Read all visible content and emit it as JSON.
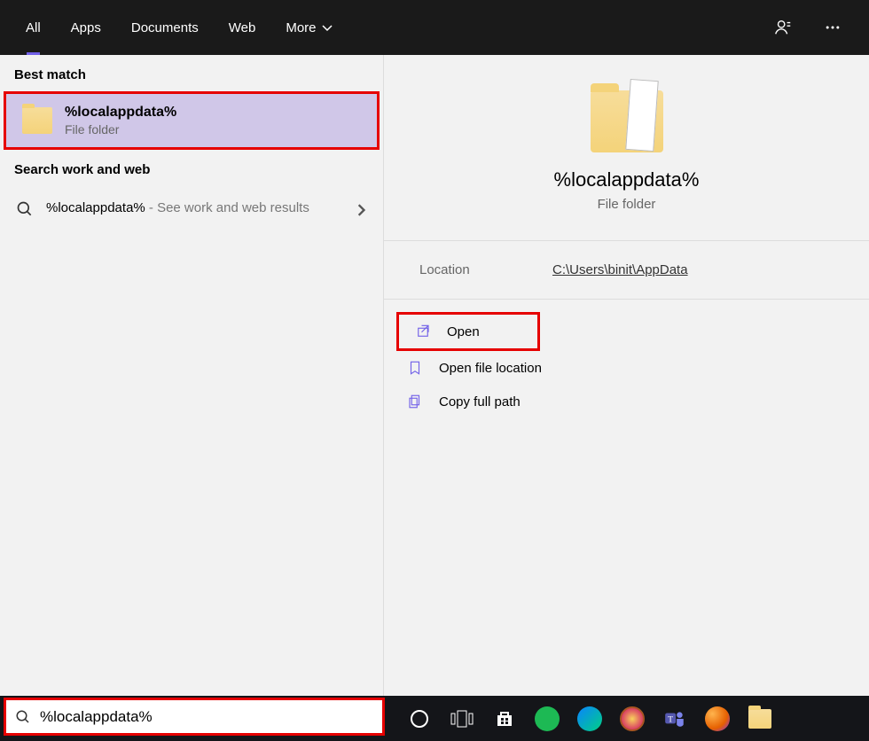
{
  "tabs": {
    "all": "All",
    "apps": "Apps",
    "documents": "Documents",
    "web": "Web",
    "more": "More"
  },
  "left": {
    "best_match": "Best match",
    "result": {
      "title": "%localappdata%",
      "sub": "File folder"
    },
    "search_work_web": "Search work and web",
    "web": {
      "query": "%localappdata%",
      "rest": " - See work and web results"
    }
  },
  "right": {
    "title": "%localappdata%",
    "sub": "File folder",
    "location_label": "Location",
    "location_value": "C:\\Users\\binit\\AppData",
    "actions": {
      "open": "Open",
      "open_loc": "Open file location",
      "copy": "Copy full path"
    }
  },
  "taskbar": {
    "search_value": "%localappdata%"
  }
}
